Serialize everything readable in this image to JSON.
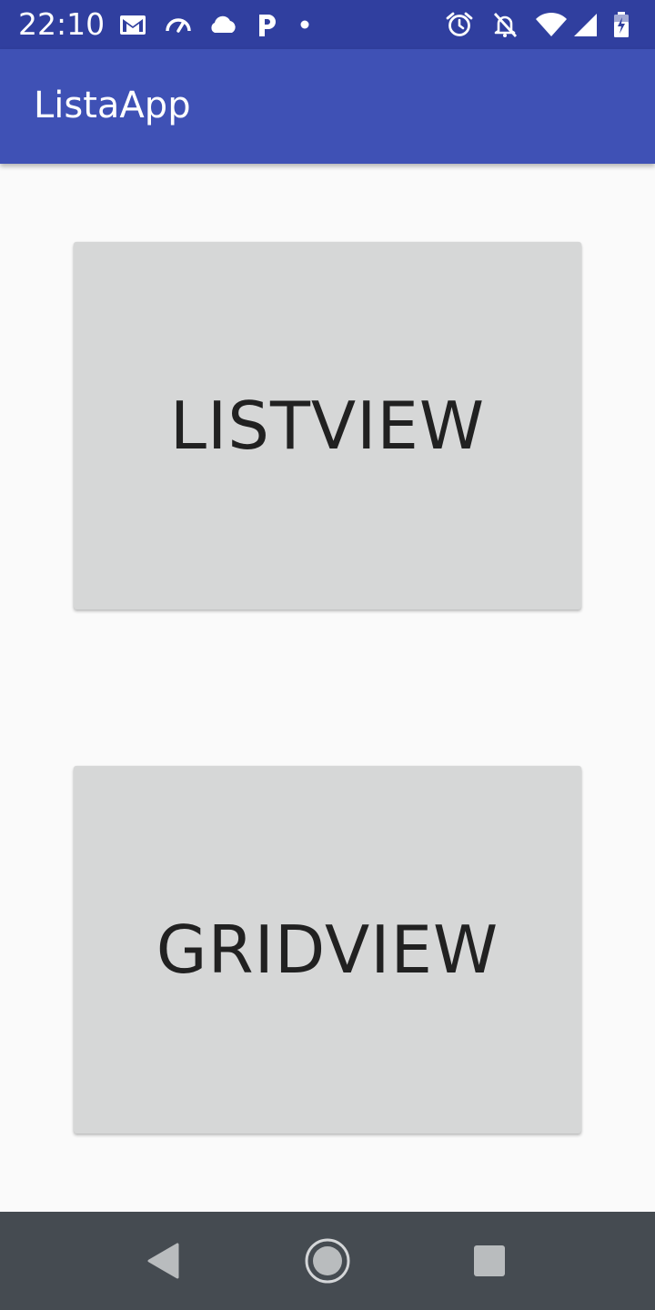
{
  "status_bar": {
    "time": "22:10",
    "icons": [
      "gmail-icon",
      "speedometer-icon",
      "cloud-icon",
      "p-icon",
      "dot-icon",
      "alarm-icon",
      "notifications-off-icon",
      "wifi-icon",
      "signal-icon",
      "battery-charging-icon"
    ]
  },
  "app_bar": {
    "title": "ListaApp"
  },
  "main": {
    "listview_label": "LISTVIEW",
    "gridview_label": "GRIDVIEW"
  },
  "nav_bar": {
    "icons": [
      "back-icon",
      "home-icon",
      "recents-icon"
    ]
  },
  "colors": {
    "status_bar": "#303f9f",
    "app_bar": "#3f51b5",
    "background": "#fafafa",
    "button": "#d6d7d7",
    "button_text": "#212121",
    "nav_bar": "#454b51"
  }
}
